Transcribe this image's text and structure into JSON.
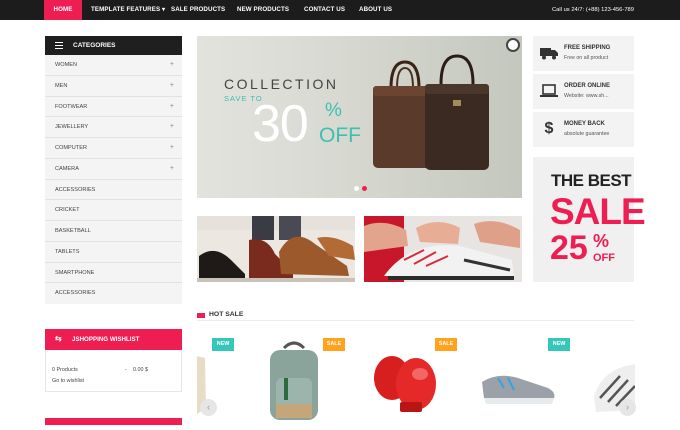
{
  "nav": {
    "items": [
      {
        "label": "HOME"
      },
      {
        "label": "TEMPLATE FEATURES ▾"
      },
      {
        "label": "SALE PRODUCTS"
      },
      {
        "label": "NEW PRODUCTS"
      },
      {
        "label": "CONTACT US"
      },
      {
        "label": "ABOUT US"
      }
    ],
    "callus": "Call us 24/7: (+88) 123-456-789"
  },
  "categories": {
    "title": "CATEGORIES",
    "items": [
      {
        "label": "WOMEN",
        "plus": "+"
      },
      {
        "label": "MEN",
        "plus": "+"
      },
      {
        "label": "FOOTWEAR",
        "plus": "+"
      },
      {
        "label": "JEWELLERY",
        "plus": "+"
      },
      {
        "label": "COMPUTER",
        "plus": "+"
      },
      {
        "label": "CAMERA",
        "plus": "+"
      },
      {
        "label": "ACCESSORIES",
        "plus": ""
      },
      {
        "label": "CRICKET",
        "plus": ""
      },
      {
        "label": "BASKETBALL",
        "plus": ""
      },
      {
        "label": "TABLETS",
        "plus": ""
      },
      {
        "label": "SMARTPHONE",
        "plus": ""
      },
      {
        "label": "ACCESSORIES",
        "plus": ""
      }
    ]
  },
  "wishlist": {
    "title": "JSHOPPING WISHLIST",
    "products": "0 Products",
    "dash": "-",
    "amount": "0.00 $",
    "link": "Go to wishlist"
  },
  "banner": {
    "collection": "COLLECTION",
    "save_to": "SAVE TO",
    "number": "30",
    "percent": "%",
    "off": "OFF"
  },
  "features": [
    {
      "icon": "truck-icon",
      "title": "FREE SHIPPING",
      "sub": "Free on all product"
    },
    {
      "icon": "laptop-icon",
      "title": "ORDER ONLINE",
      "sub": "Website: www.sh..."
    },
    {
      "icon": "dollar-icon",
      "title": "MONEY BACK",
      "sub": "absolute guarantee"
    }
  ],
  "best": {
    "line1": "THE BEST",
    "line2": "SALE",
    "line3": "25",
    "line4": "%",
    "line5": "OFF"
  },
  "hot_sale": {
    "title": "HOT SALE",
    "badges": [
      "NEW",
      "SALE",
      "SALE",
      "NEW"
    ]
  },
  "colors": {
    "accent": "#ee1d52",
    "teal": "#3dbfb1",
    "dark": "#1c1c1c",
    "sale_badge": "#ffa21c",
    "new_badge": "#35c8b8"
  }
}
